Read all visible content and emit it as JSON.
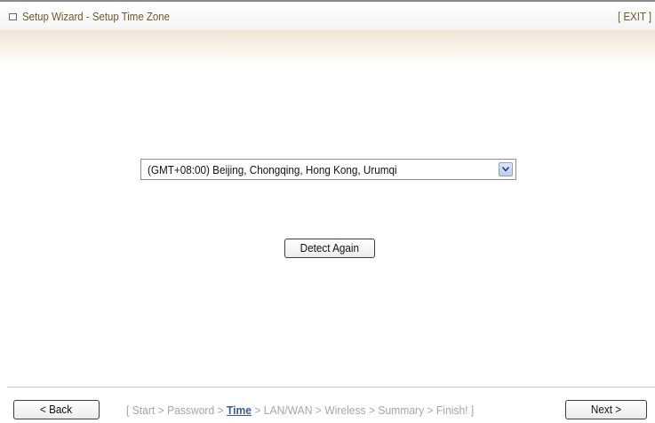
{
  "window": {
    "title": "Setup Wizard - Setup Time Zone",
    "exit_label": "[ EXIT ]"
  },
  "timezone": {
    "selected": "(GMT+08:00) Beijing, Chongqing, Hong Kong, Urumqi"
  },
  "detect_button": "Detect Again",
  "footer": {
    "back_label": "< Back",
    "next_label": "Next >",
    "steps_open": "[",
    "steps_close": "]",
    "separator": ">",
    "steps": [
      "Start",
      "Password",
      "Time",
      "LAN/WAN",
      "Wireless",
      "Summary",
      "Finish!"
    ],
    "current_step": "Time"
  },
  "colors": {
    "title_text": "#6b5a2b",
    "current_step": "#3a5b9a",
    "inactive_step": "#a6a6a6"
  }
}
